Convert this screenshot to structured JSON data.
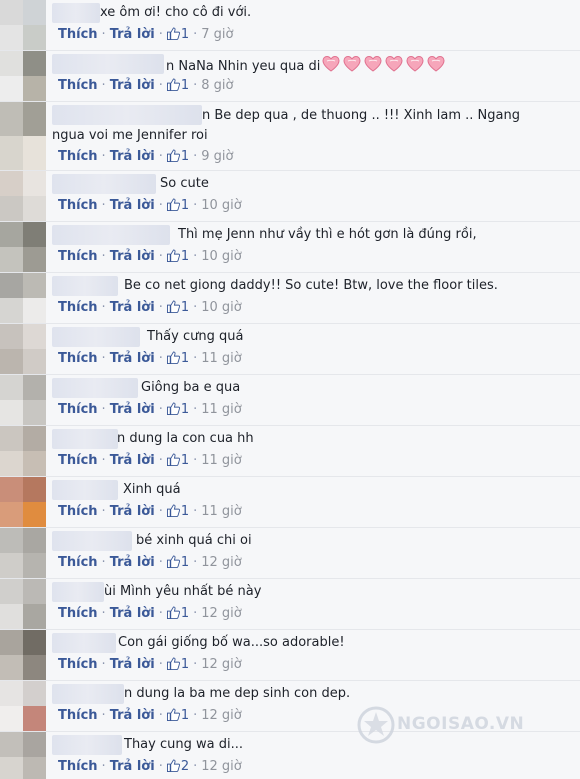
{
  "labels": {
    "like": "Thích",
    "reply": "Trả lời",
    "dot": "·"
  },
  "comments": [
    {
      "text": "xe ôm ơi! cho cô đi với.",
      "likes": "1",
      "time": "7 giờ"
    },
    {
      "text": "n NaNa Nhin yeu qua di",
      "likes": "1",
      "time": "8 giờ",
      "hearts": 6
    },
    {
      "text": "n Be dep qua , de thuong .. !!! Xinh lam .. Ngang ngua voi me Jennifer roi",
      "likes": "1",
      "time": "9 giờ"
    },
    {
      "text": "So cute",
      "likes": "1",
      "time": "10 giờ"
    },
    {
      "text": "Thì mẹ Jenn như vầy thì e hót gơn là đúng rồi,",
      "likes": "1",
      "time": "10 giờ"
    },
    {
      "text": "Be co net giong daddy!! So cute! Btw, love the floor tiles.",
      "likes": "1",
      "time": "10 giờ"
    },
    {
      "text": "Thấy cưng quá",
      "likes": "1",
      "time": "11 giờ"
    },
    {
      "text": "Giông ba e qua",
      "likes": "1",
      "time": "11 giờ"
    },
    {
      "text": "n dung la con cua hh",
      "likes": "1",
      "time": "11 giờ"
    },
    {
      "text": "Xinh quá",
      "likes": "1",
      "time": "11 giờ"
    },
    {
      "text": "bé xinh quá chi oi",
      "likes": "1",
      "time": "12 giờ"
    },
    {
      "text": "ùi Mình yêu nhất bé này",
      "likes": "1",
      "time": "12 giờ"
    },
    {
      "text": "Con gái giống bố wa...so adorable!",
      "likes": "1",
      "time": "12 giờ"
    },
    {
      "text": "n dung la ba me dep sinh con dep.",
      "likes": "1",
      "time": "12 giờ"
    },
    {
      "text": "Thay cung wa di...",
      "likes": "2",
      "time": "12 giờ"
    }
  ],
  "watermark": "NGOISAO.VN",
  "colors": {
    "link": "#3b5998",
    "time": "#90949c",
    "text": "#1d2129"
  }
}
